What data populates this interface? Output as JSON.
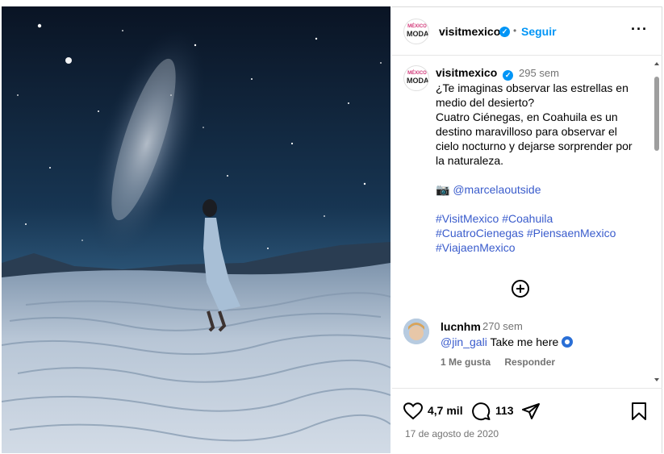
{
  "post": {
    "account": "visitmexico",
    "follow_label": "Seguir",
    "logo_line1": "MÉXICO",
    "logo_line2": "MODA",
    "caption_time": "295 sem",
    "caption_lines": [
      "¿Te imaginas observar las estrellas en",
      "medio del desierto?",
      "Cuatro Ciénegas, en Coahuila es un",
      "destino maravilloso para observar el",
      "cielo nocturno y dejarse sorprender por",
      "la naturaleza."
    ],
    "credit": "@marcelaoutside",
    "hashtags_line1": "#VisitMexico #Coahuila",
    "hashtags_line2": "#CuatroCienegas #PiensaenMexico",
    "hashtags_line3": "#ViajaenMexico",
    "likes": "4,7 mil",
    "comments_count": "113",
    "date": "17 de agosto de 2020"
  },
  "comment": {
    "user": "lucnhm",
    "time": "270 sem",
    "mention": "@jin_gali",
    "text": "Take me here",
    "likes_label": "1 Me gusta",
    "reply_label": "Responder"
  },
  "icons": {
    "verified": "verified-badge-icon",
    "more": "more-options-icon",
    "camera": "camera-emoji-icon",
    "add": "add-circle-icon",
    "like": "heart-icon",
    "comment": "comment-bubble-icon",
    "share": "paper-plane-icon",
    "save": "bookmark-icon",
    "eye": "nazar-eye-emoji-icon"
  },
  "colors": {
    "link": "#0095f6",
    "hashtag": "#3a5ccc",
    "verified": "#0095f6",
    "muted": "#737373"
  }
}
